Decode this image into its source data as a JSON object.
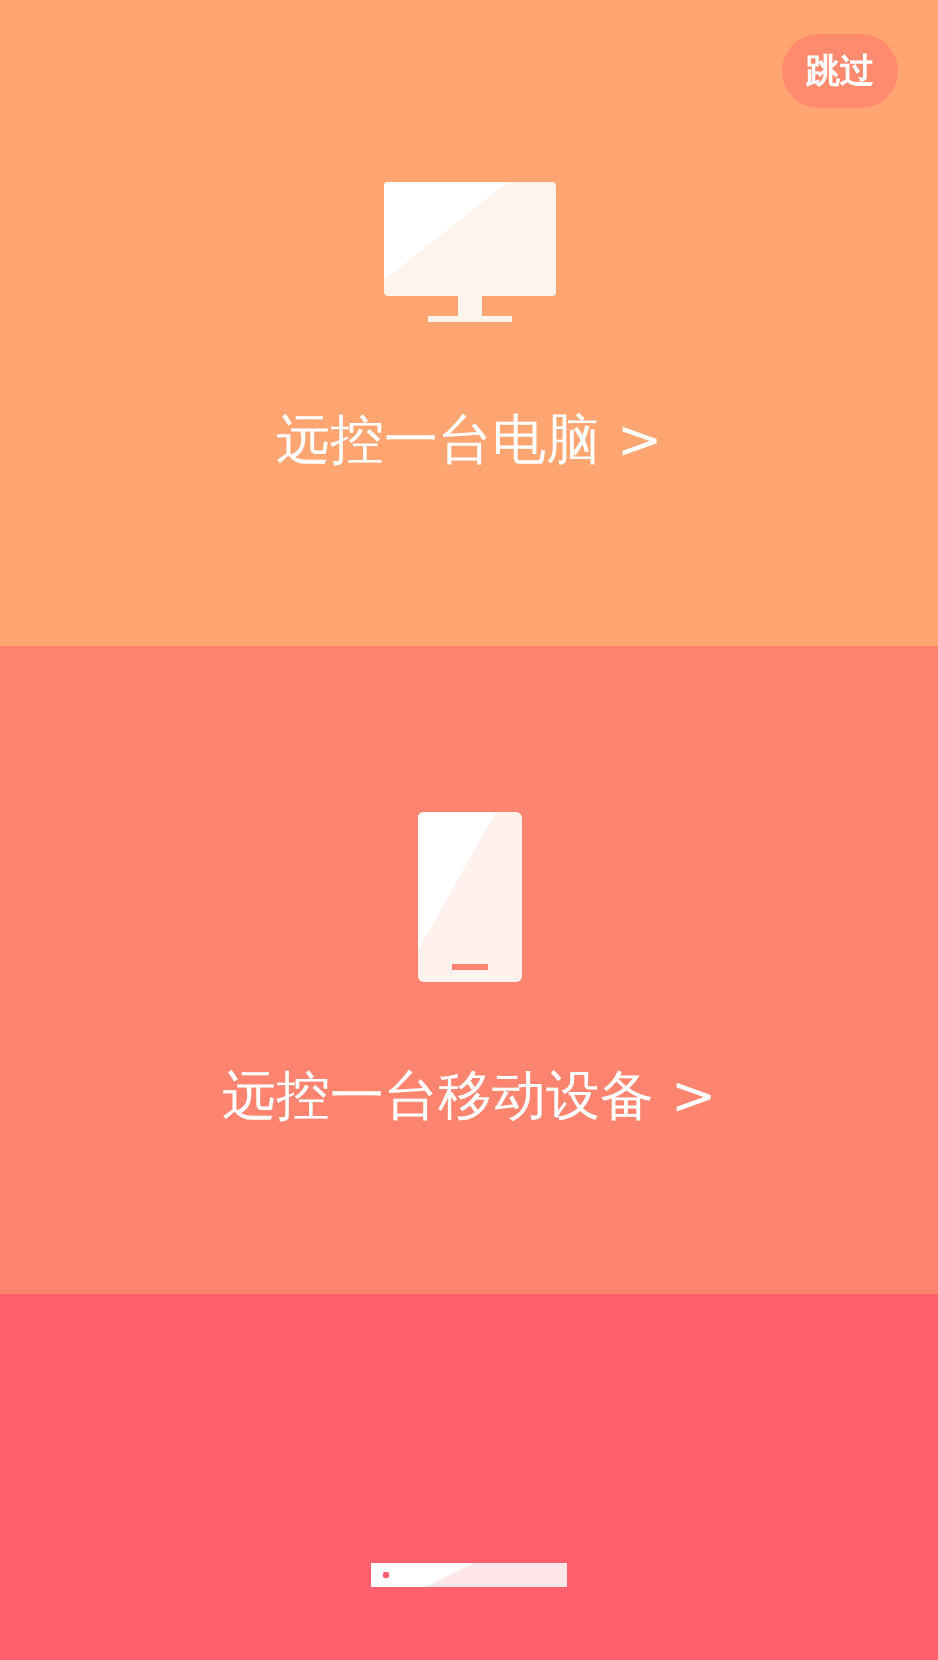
{
  "skip_button": {
    "label": "跳过"
  },
  "panels": [
    {
      "kind": "computer",
      "label": "远控一台电脑 >"
    },
    {
      "kind": "mobile",
      "label": "远控一台移动设备 >"
    },
    {
      "kind": "slab"
    }
  ]
}
